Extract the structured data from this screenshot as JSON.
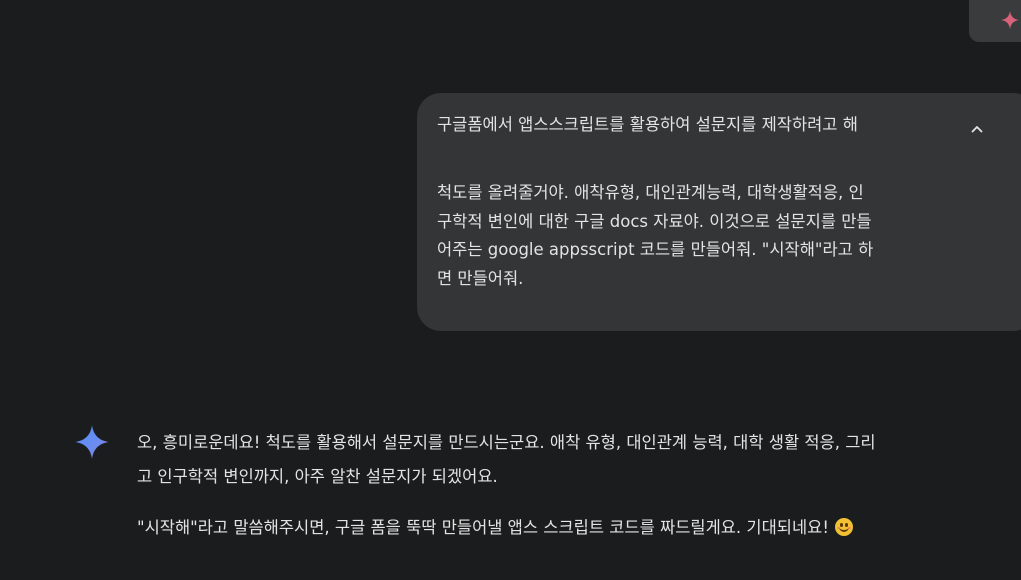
{
  "top_chip": {
    "icon": "gemini-spark-icon",
    "accent": "#e06c7a"
  },
  "user_message": {
    "first_line": "구글폼에서 앱스스크립트를 활용하여 설문지를 제작하려고 해",
    "expand_icon": "chevron-up-icon",
    "lines": [
      "척도를 올려줄거야. 애착유형, 대인관계능력, 대학생활적응, 인",
      "구학적 변인에 대한 구글 docs 자료야. 이것으로 설문지를 만들",
      "어주는 google appsscript 코드를 만들어줘. \"시작해\"라고 하",
      "면 만들어줘."
    ]
  },
  "assistant_message": {
    "avatar_icon": "gemini-sparkle-icon",
    "paragraphs": [
      {
        "lines": [
          "오, 흥미로운데요! 척도를 활용해서 설문지를 만드시는군요. 애착 유형, 대인관계 능력, 대학 생활 적응, 그리",
          "고 인구학적 변인까지, 아주 알찬 설문지가 되겠어요."
        ]
      },
      {
        "lines": [
          "\"시작해\"라고 말씀해주시면, 구글 폼을 뚝딱 만들어낼 앱스 스크립트 코드를 짜드릴게요. 기대되네요!"
        ],
        "emoji": "smiling-face-emoji"
      }
    ]
  },
  "colors": {
    "background": "#1b1c1d",
    "bubble": "#333537",
    "text": "#e3e3e3",
    "gemini_blue": "#4f8ff7",
    "gemini_purple": "#9b72cb"
  }
}
